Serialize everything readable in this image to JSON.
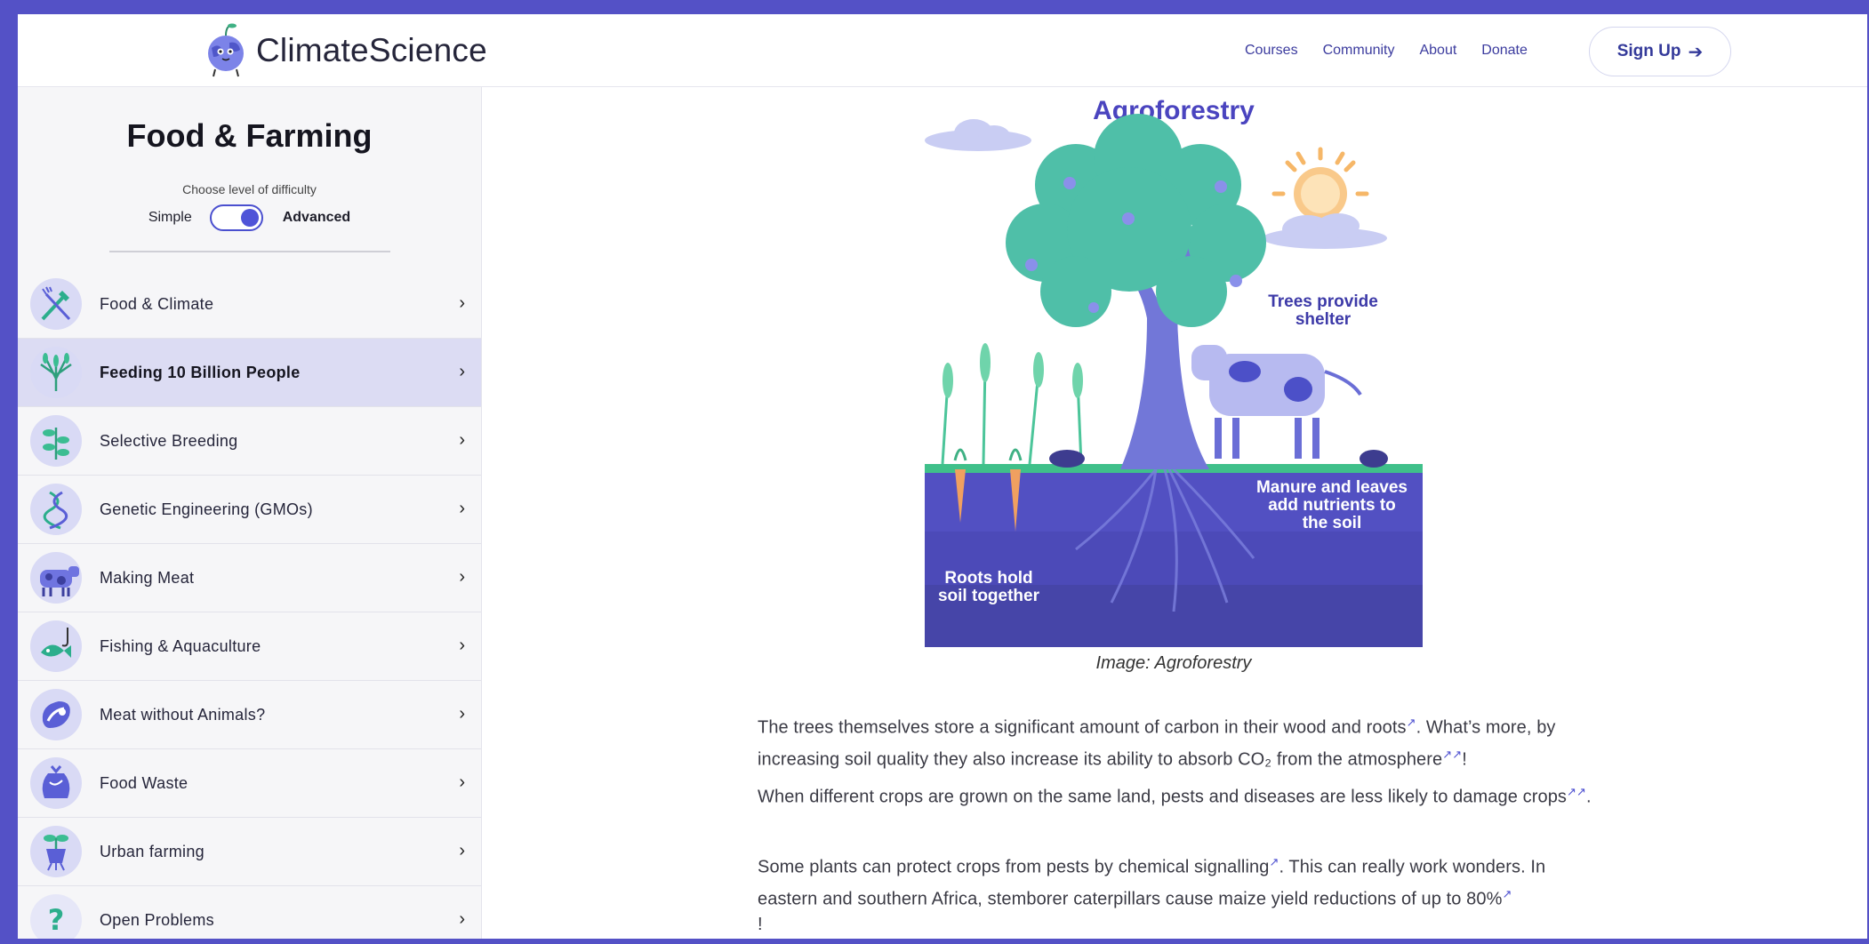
{
  "header": {
    "logo_text": "ClimateScience",
    "nav": [
      "Courses",
      "Community",
      "About",
      "Donate"
    ],
    "signup_label": "Sign Up",
    "signup_arrow": "➔"
  },
  "sidebar": {
    "title": "Food & Farming",
    "difficulty_label": "Choose level of difficulty",
    "simple_label": "Simple",
    "advanced_label": "Advanced",
    "toggle_state": "advanced",
    "chevron": "›",
    "items": [
      {
        "label": "Food & Climate",
        "icon": "shovel-fork-icon"
      },
      {
        "label": "Feeding 10 Billion People",
        "icon": "wheat-icon",
        "active": true
      },
      {
        "label": "Selective Breeding",
        "icon": "plant-icon"
      },
      {
        "label": "Genetic Engineering (GMOs)",
        "icon": "dna-icon"
      },
      {
        "label": "Making Meat",
        "icon": "cow-icon"
      },
      {
        "label": "Fishing & Aquaculture",
        "icon": "fish-hook-icon"
      },
      {
        "label": "Meat without Animals?",
        "icon": "steak-icon"
      },
      {
        "label": "Food Waste",
        "icon": "garbage-bag-icon"
      },
      {
        "label": "Urban farming",
        "icon": "potted-plant-icon"
      },
      {
        "label": "Open Problems",
        "icon": "question-icon"
      }
    ]
  },
  "main": {
    "illustration": {
      "title": "Agroforestry",
      "label_shelter": [
        "Trees provide",
        "shelter"
      ],
      "label_manure": [
        "Manure and leaves",
        "add nutrients to",
        "the soil"
      ],
      "label_roots": [
        "Roots hold",
        "soil together"
      ]
    },
    "caption": "Image: Agroforestry",
    "ext_icon": "↗",
    "p1": {
      "a": "The trees themselves store a significant amount of carbon in their wood and roots",
      "b": ". What’s more, by increasing soil quality they also increase its ability to absorb CO₂ from the atmosphere",
      "c": "!"
    },
    "p2": {
      "a": "When different crops are grown on the same land, pests and diseases are less likely to damage crops",
      "b": "."
    },
    "p3": {
      "a": "Some plants can protect crops from pests by chemical signalling",
      "b": ". This can really work wonders. In eastern and southern Africa, stemborer caterpillars cause maize yield reductions of up to 80%",
      "c": "!"
    }
  },
  "colors": {
    "frame": "#5451c6",
    "accent": "#4a44bf",
    "active_item": "#dcdcf3",
    "soil": "#5250c2"
  }
}
